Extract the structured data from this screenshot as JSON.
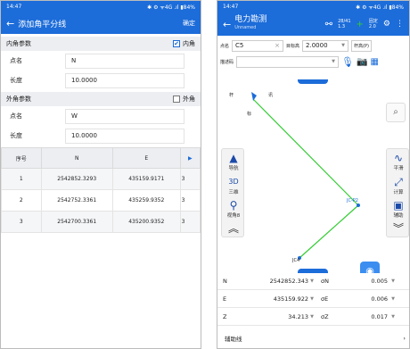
{
  "left": {
    "status_time": "14:47",
    "status_right": "✱ ⚙ ᯤ4G .ıl ▮84%",
    "title": "添加角平分线",
    "confirm": "确定",
    "inner": {
      "header": "内角参数",
      "checkbox_label": "内角",
      "checked": true,
      "point_name_label": "点名",
      "point_name": "N",
      "length_label": "长度",
      "length": "10.0000"
    },
    "outer": {
      "header": "外角参数",
      "checkbox_label": "外角",
      "checked": false,
      "point_name_label": "点名",
      "point_name": "W",
      "length_label": "长度",
      "length": "10.0000"
    },
    "table": {
      "headers": [
        "序号",
        "N",
        "E"
      ],
      "rows": [
        [
          "1",
          "2542852.3293",
          "435159.9171",
          "3"
        ],
        [
          "2",
          "2542752.3361",
          "435259.9352",
          "3"
        ],
        [
          "3",
          "2542700.3361",
          "435200.9352",
          "3"
        ]
      ]
    }
  },
  "right": {
    "status_time": "14:47",
    "status_right": "✱ ⚙ ᯤ4G .ıl ▮84%",
    "title": "电力勘测",
    "subtitle": "Unnamed",
    "sat_badge": "28/41",
    "sat_sub": "1.3",
    "fix_label": "固定",
    "fix_sub": "2.0",
    "point_label": "点名",
    "point_value": "C5",
    "target_label": "目标高",
    "target_value": "2.0000",
    "pole_label": "杆高(P)",
    "desc_label": "描述码",
    "map_labels": {
      "top_a": "杆",
      "top_b": "讯",
      "top_c": "标",
      "mid": "JC-P2",
      "bottom": "JC4"
    },
    "tools_left": [
      "导航",
      "三维",
      "视角8"
    ],
    "tools_right": [
      "平滑",
      "计算",
      "辅助"
    ],
    "readout": [
      {
        "label": "N",
        "value": "2542852.343",
        "dlabel": "σN",
        "dvalue": "0.005"
      },
      {
        "label": "E",
        "value": "435159.922",
        "dlabel": "σE",
        "dvalue": "0.006"
      },
      {
        "label": "Z",
        "value": "34.213",
        "dlabel": "σZ",
        "dvalue": "0.017"
      }
    ],
    "assist_line": "辅助线"
  },
  "colors": {
    "primary": "#1c6cd9",
    "line": "#33cc33"
  }
}
